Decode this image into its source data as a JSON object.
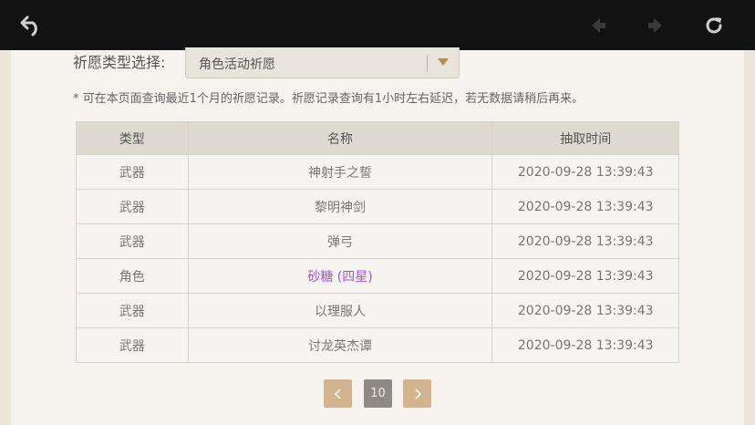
{
  "filter": {
    "label": "祈愿类型选择:",
    "selected": "角色活动祈愿"
  },
  "notice": "* 可在本页面查询最近1个月的祈愿记录。祈愿记录查询有1小时左右延迟，若无数据请稍后再来。",
  "table": {
    "headers": [
      "类型",
      "名称",
      "抽取时间"
    ],
    "rows": [
      {
        "type": "武器",
        "name": "神射手之誓",
        "time": "2020-09-28 13:39:43"
      },
      {
        "type": "武器",
        "name": "黎明神剑",
        "time": "2020-09-28 13:39:43"
      },
      {
        "type": "武器",
        "name": "弹弓",
        "time": "2020-09-28 13:39:43"
      },
      {
        "type": "角色",
        "name": "砂糖 (四星)",
        "time": "2020-09-28 13:39:43"
      },
      {
        "type": "武器",
        "name": "以理服人",
        "time": "2020-09-28 13:39:43"
      },
      {
        "type": "武器",
        "name": "讨龙英杰谭",
        "time": "2020-09-28 13:39:43"
      }
    ]
  },
  "pagination": {
    "current": "10",
    "prev_icon": "chevron-left-icon",
    "next_icon": "chevron-right-icon"
  },
  "colors": {
    "four_star": "#a253d6",
    "accent": "#d3b48e"
  }
}
